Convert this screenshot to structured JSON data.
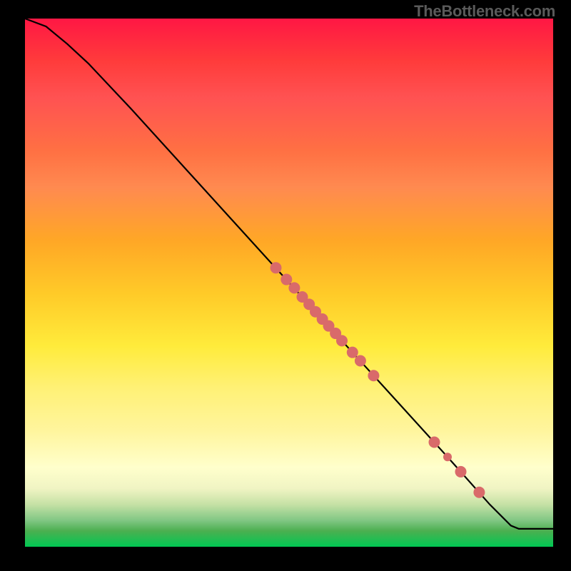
{
  "watermark": "TheBottleneck.com",
  "chart_data": {
    "type": "line",
    "title": "",
    "xlabel": "",
    "ylabel": "",
    "xlim": [
      0,
      100
    ],
    "ylim": [
      0,
      100
    ],
    "grid": false,
    "curve": [
      {
        "x": 0,
        "y": 100
      },
      {
        "x": 4,
        "y": 98.5
      },
      {
        "x": 8,
        "y": 95.2
      },
      {
        "x": 12,
        "y": 91.5
      },
      {
        "x": 20,
        "y": 83
      },
      {
        "x": 30,
        "y": 72
      },
      {
        "x": 40,
        "y": 61
      },
      {
        "x": 50,
        "y": 50
      },
      {
        "x": 60,
        "y": 39
      },
      {
        "x": 70,
        "y": 28
      },
      {
        "x": 80,
        "y": 17
      },
      {
        "x": 88,
        "y": 8
      },
      {
        "x": 92,
        "y": 4
      },
      {
        "x": 93.5,
        "y": 3.4
      },
      {
        "x": 100,
        "y": 3.4
      }
    ],
    "markers": [
      {
        "x": 47.5,
        "y": 52.8,
        "r": 8
      },
      {
        "x": 49.5,
        "y": 50.6,
        "r": 8
      },
      {
        "x": 51.0,
        "y": 49.0,
        "r": 8
      },
      {
        "x": 52.5,
        "y": 47.3,
        "r": 8
      },
      {
        "x": 53.8,
        "y": 45.9,
        "r": 8
      },
      {
        "x": 55.0,
        "y": 44.5,
        "r": 8
      },
      {
        "x": 56.3,
        "y": 43.1,
        "r": 8
      },
      {
        "x": 57.5,
        "y": 41.8,
        "r": 8
      },
      {
        "x": 58.8,
        "y": 40.4,
        "r": 8
      },
      {
        "x": 60.0,
        "y": 39.0,
        "r": 8
      },
      {
        "x": 62.0,
        "y": 36.8,
        "r": 8
      },
      {
        "x": 63.5,
        "y": 35.2,
        "r": 8
      },
      {
        "x": 66.0,
        "y": 32.4,
        "r": 8
      },
      {
        "x": 77.5,
        "y": 19.8,
        "r": 8
      },
      {
        "x": 80.0,
        "y": 17.0,
        "r": 6
      },
      {
        "x": 82.5,
        "y": 14.2,
        "r": 8
      },
      {
        "x": 86.0,
        "y": 10.3,
        "r": 8
      }
    ]
  }
}
